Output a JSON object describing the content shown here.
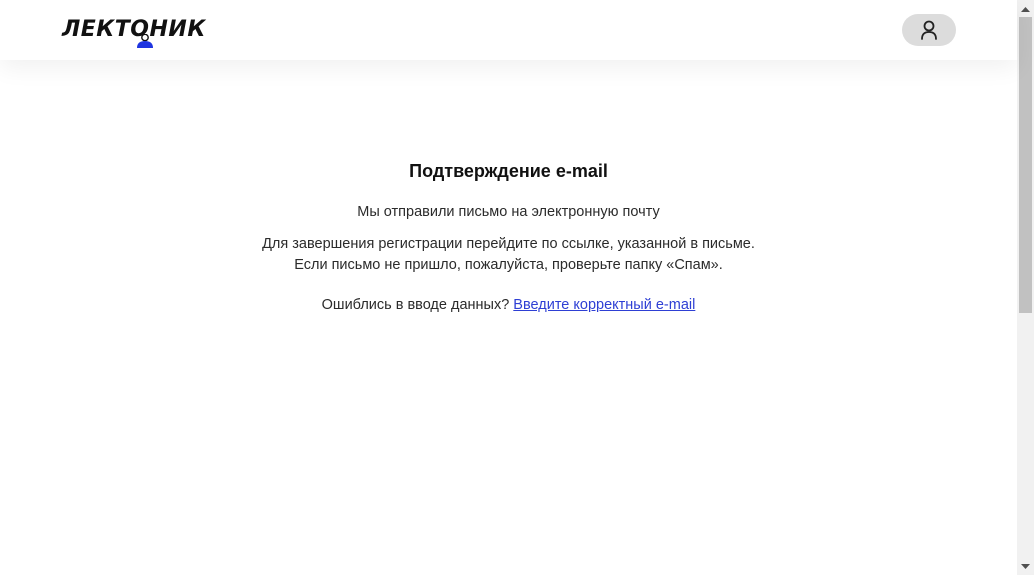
{
  "header": {
    "logo_text": "ЛЕКТОНИК",
    "account_icon": "user-icon",
    "account_button_color": "#dcdcdc"
  },
  "main": {
    "title": "Подтверждение e-mail",
    "sent_message": "Мы отправили письмо на электронную почту",
    "instruction_line1": "Для завершения регистрации перейдите по ссылке, указанной в письме.",
    "instruction_line2": "Если письмо не пришло, пожалуйста, проверьте папку «Спам».",
    "error_prompt": "Ошиблись в вводе данных?",
    "correct_email_link": "Введите корректный e-mail"
  },
  "colors": {
    "link": "#2e3fd4",
    "mascot": "#1f35e0",
    "text": "#2b2b2b"
  }
}
